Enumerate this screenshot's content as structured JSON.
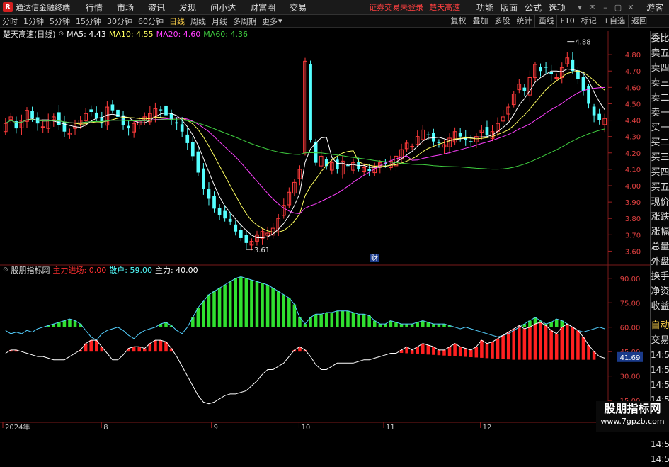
{
  "menubar": {
    "logo_glyph": "R",
    "app_name": "通达信金融终端",
    "items": [
      "行情",
      "市场",
      "资讯",
      "发现",
      "问小达",
      "财富圈",
      "交易"
    ],
    "notice_login": "证券交易未登录",
    "notice_stock": "楚天高速",
    "right_items": [
      "功能",
      "版面",
      "公式",
      "选项"
    ],
    "user": "游客"
  },
  "toolbar": {
    "periods": [
      "分时",
      "1分钟",
      "5分钟",
      "15分钟",
      "30分钟",
      "60分钟",
      "日线",
      "周线",
      "月线",
      "多周期",
      "更多"
    ],
    "selected_period": "日线",
    "tools": [
      "复权",
      "叠加",
      "多股",
      "统计",
      "画线",
      "F10",
      "标记",
      "+自选",
      "返回"
    ]
  },
  "main_chart": {
    "stock_label": "楚天高速(日线)",
    "ma5_label": "MA5: 4.43",
    "ma10_label": "MA10: 4.55",
    "ma20_label": "MA20: 4.60",
    "ma60_label": "MA60: 4.36",
    "high_marker": "4.88",
    "low_marker": "3.61",
    "finance_marker": "财",
    "y_ticks": [
      "4.80",
      "4.70",
      "4.60",
      "4.50",
      "4.40",
      "4.30",
      "4.20",
      "4.10",
      "4.00",
      "3.90",
      "3.80",
      "3.70",
      "3.60"
    ]
  },
  "indicator": {
    "name": "股朋指标网",
    "zhuli_jinchang": "主力进场: 0.00",
    "sanhu": "散户: 59.00",
    "zhuli": "主力: 40.00",
    "y_ticks": [
      "90.00",
      "75.00",
      "60.00",
      "45.00",
      "30.00",
      "15.00"
    ],
    "current_value": "41.69"
  },
  "x_axis": [
    "2024年",
    "8",
    "9",
    "10",
    "11",
    "12"
  ],
  "right_panel": {
    "quote_labels": [
      "委比",
      "卖五",
      "卖四",
      "卖三",
      "卖二",
      "卖一",
      "买一",
      "买二",
      "买三",
      "买四",
      "买五",
      "现价",
      "涨跌",
      "涨幅",
      "总量",
      "外盘",
      "换手",
      "净资",
      "收益"
    ],
    "lower_labels": [
      "自动",
      "交易"
    ],
    "time_rows": [
      "14:56",
      "14:56",
      "14:56",
      "14:56",
      "14:56",
      "14:56",
      "14:56",
      "14:56"
    ]
  },
  "watermark": {
    "line1": "股朋指标网",
    "line2": "www.7gpzb.com"
  },
  "colors": {
    "up": "#ff3b3b",
    "down": "#54ffff",
    "ma5": "#ffffff",
    "ma10": "#ffff60",
    "ma20": "#ff40ff",
    "ma60": "#40d040",
    "green_hist": "#30e030",
    "red_hist": "#ff2020"
  },
  "chart_data": [
    {
      "type": "candlestick",
      "title": "楚天高速(日线)",
      "ylim": [
        3.55,
        4.9
      ],
      "y_ticks": [
        4.8,
        4.7,
        4.6,
        4.5,
        4.4,
        4.3,
        4.2,
        4.1,
        4.0,
        3.9,
        3.8,
        3.7,
        3.6
      ],
      "x_labels": [
        "2024年",
        "8",
        "9",
        "10",
        "11",
        "12"
      ],
      "series": [
        {
          "name": "MA5",
          "value": 4.43
        },
        {
          "name": "MA10",
          "value": 4.55
        },
        {
          "name": "MA20",
          "value": 4.6
        },
        {
          "name": "MA60",
          "value": 4.36
        }
      ],
      "close": [
        4.38,
        4.42,
        4.35,
        4.4,
        4.46,
        4.41,
        4.38,
        4.36,
        4.4,
        4.42,
        4.37,
        4.33,
        4.32,
        4.36,
        4.4,
        4.44,
        4.45,
        4.41,
        4.38,
        4.48,
        4.46,
        4.42,
        4.37,
        4.35,
        4.38,
        4.4,
        4.42,
        4.44,
        4.47,
        4.46,
        4.43,
        4.4,
        4.38,
        4.33,
        4.26,
        4.18,
        4.08,
        3.98,
        3.92,
        3.86,
        3.82,
        3.8,
        3.78,
        3.72,
        3.68,
        3.65,
        3.66,
        3.7,
        3.72,
        3.71,
        3.74,
        3.8,
        3.88,
        3.96,
        4.02,
        4.1,
        4.76,
        4.28,
        4.14,
        4.18,
        4.12,
        4.14,
        4.1,
        4.15,
        4.12,
        4.14,
        4.1,
        4.11,
        4.09,
        4.12,
        4.14,
        4.13,
        4.15,
        4.18,
        4.22,
        4.26,
        4.24,
        4.3,
        4.34,
        4.31,
        4.27,
        4.26,
        4.25,
        4.29,
        4.33,
        4.3,
        4.28,
        4.27,
        4.3,
        4.34,
        4.31,
        4.33,
        4.38,
        4.42,
        4.48,
        4.56,
        4.62,
        4.58,
        4.66,
        4.74,
        4.7,
        4.72,
        4.68,
        4.66,
        4.72,
        4.78,
        4.7,
        4.65,
        4.58,
        4.5,
        4.43,
        4.4,
        4.41
      ],
      "low_marker": 3.61,
      "high_marker": 4.88
    },
    {
      "type": "bar",
      "title": "股朋指标网",
      "ylim": [
        12,
        96
      ],
      "y_ticks": [
        90,
        75,
        60,
        45,
        30,
        15
      ],
      "series": [
        {
          "name": "散户",
          "value": 59.0
        },
        {
          "name": "主力",
          "value": 40.0
        },
        {
          "name": "主力进场",
          "value": 0.0
        }
      ],
      "sanhu": [
        58,
        56,
        57,
        56,
        58,
        57,
        59,
        60,
        61,
        62,
        63,
        64,
        65,
        64,
        62,
        58,
        54,
        52,
        56,
        58,
        59,
        60,
        58,
        55,
        53,
        56,
        58,
        59,
        60,
        62,
        63,
        61,
        58,
        56,
        60,
        66,
        72,
        76,
        80,
        82,
        84,
        86,
        88,
        90,
        91,
        90,
        89,
        88,
        87,
        86,
        84,
        82,
        80,
        78,
        74,
        66,
        62,
        66,
        68,
        68,
        69,
        69,
        70,
        70,
        70,
        69,
        68,
        68,
        67,
        64,
        62,
        62,
        64,
        63,
        62,
        62,
        62,
        63,
        64,
        63,
        62,
        62,
        62,
        61,
        60,
        59,
        60,
        59,
        58,
        57,
        56,
        55,
        54,
        55,
        56,
        58,
        60,
        62,
        64,
        66,
        64,
        62,
        63,
        65,
        64,
        62,
        60,
        58,
        57,
        58,
        59,
        60,
        59
      ],
      "zhuli": [
        44,
        46,
        46,
        45,
        44,
        43,
        42,
        42,
        41,
        40,
        40,
        40,
        42,
        44,
        46,
        50,
        52,
        52,
        48,
        44,
        40,
        40,
        43,
        47,
        48,
        48,
        47,
        50,
        52,
        52,
        51,
        47,
        42,
        36,
        30,
        24,
        18,
        14,
        13,
        14,
        16,
        18,
        19,
        19,
        20,
        21,
        24,
        27,
        31,
        34,
        34,
        36,
        38,
        42,
        46,
        48,
        46,
        42,
        37,
        34,
        34,
        36,
        38,
        38,
        38,
        38,
        39,
        40,
        40,
        41,
        42,
        43,
        44,
        44,
        46,
        48,
        46,
        48,
        50,
        49,
        48,
        46,
        46,
        48,
        50,
        48,
        47,
        46,
        48,
        52,
        50,
        51,
        53,
        55,
        57,
        59,
        61,
        59,
        60,
        62,
        63,
        61,
        58,
        56,
        60,
        62,
        60,
        58,
        54,
        49,
        45,
        42,
        41
      ]
    }
  ]
}
